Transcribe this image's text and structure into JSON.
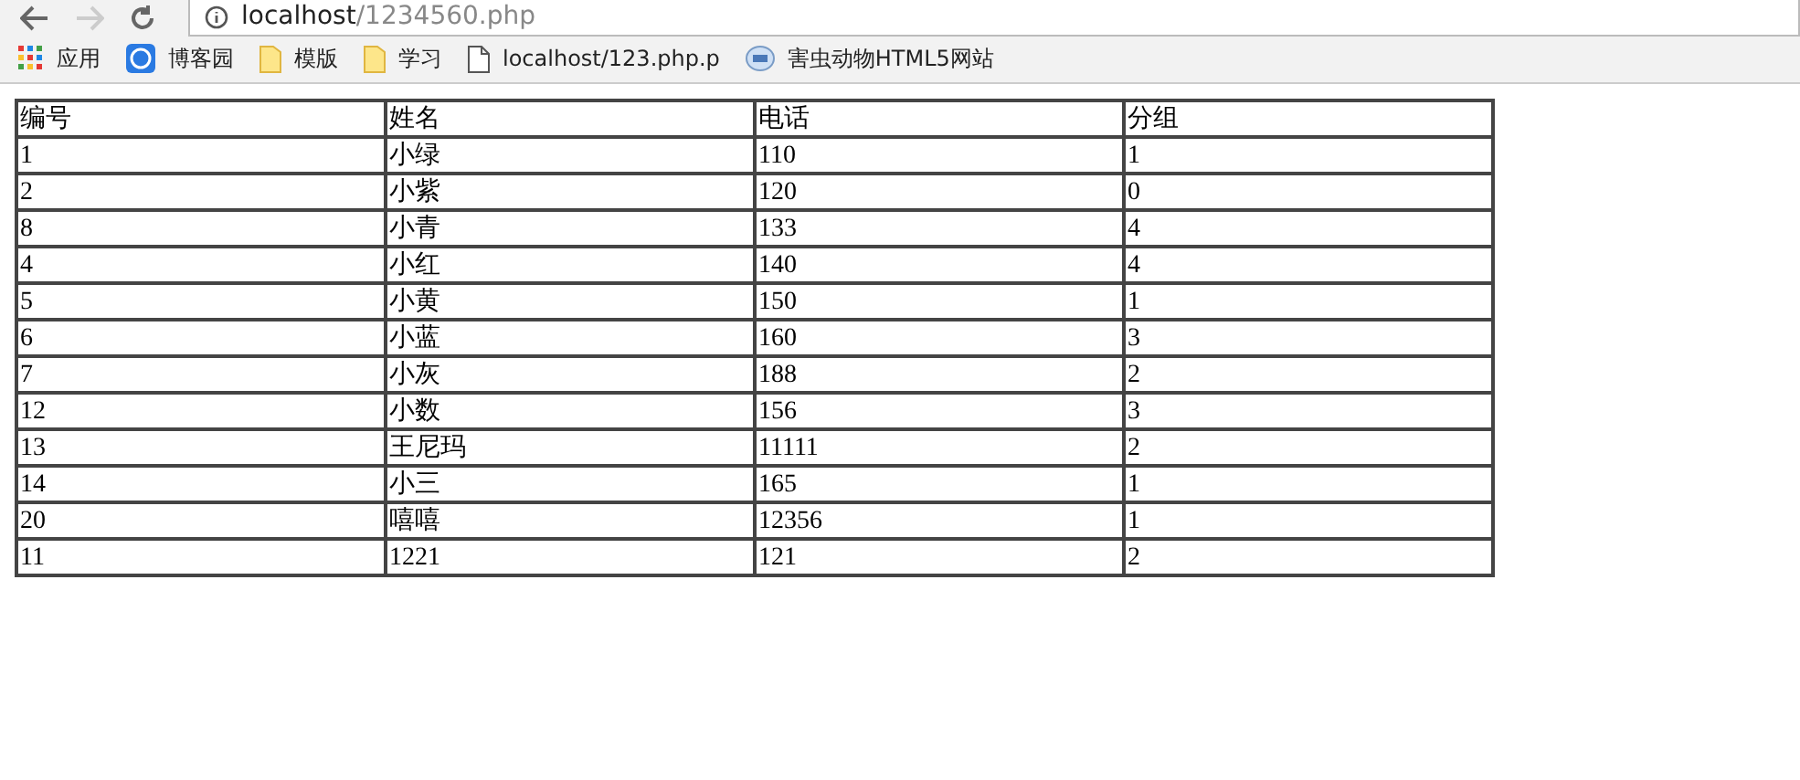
{
  "toolbar": {
    "url": {
      "host": "localhost",
      "path": "/1234560.php"
    }
  },
  "bookmarks": [
    {
      "kind": "apps",
      "label": "应用"
    },
    {
      "kind": "site",
      "label": "博客园"
    },
    {
      "kind": "folder",
      "label": "模版"
    },
    {
      "kind": "folder",
      "label": "学习"
    },
    {
      "kind": "page",
      "label": "localhost/123.php.p"
    },
    {
      "kind": "globe",
      "label": "害虫动物HTML5网站"
    }
  ],
  "table": {
    "columns": [
      "编号",
      "姓名",
      "电话",
      "分组"
    ],
    "rows": [
      [
        "1",
        "小绿",
        "110",
        "1"
      ],
      [
        "2",
        "小紫",
        "120",
        "0"
      ],
      [
        "8",
        "小青",
        "133",
        "4"
      ],
      [
        "4",
        "小红",
        "140",
        "4"
      ],
      [
        "5",
        "小黄",
        "150",
        "1"
      ],
      [
        "6",
        "小蓝",
        "160",
        "3"
      ],
      [
        "7",
        "小灰",
        "188",
        "2"
      ],
      [
        "12",
        "小数",
        "156",
        "3"
      ],
      [
        "13",
        "王尼玛",
        "11111",
        "2"
      ],
      [
        "14",
        "小三",
        "165",
        "1"
      ],
      [
        "20",
        "嘻嘻",
        "12356",
        "1"
      ],
      [
        "11",
        "1221",
        "121",
        "2"
      ]
    ]
  }
}
